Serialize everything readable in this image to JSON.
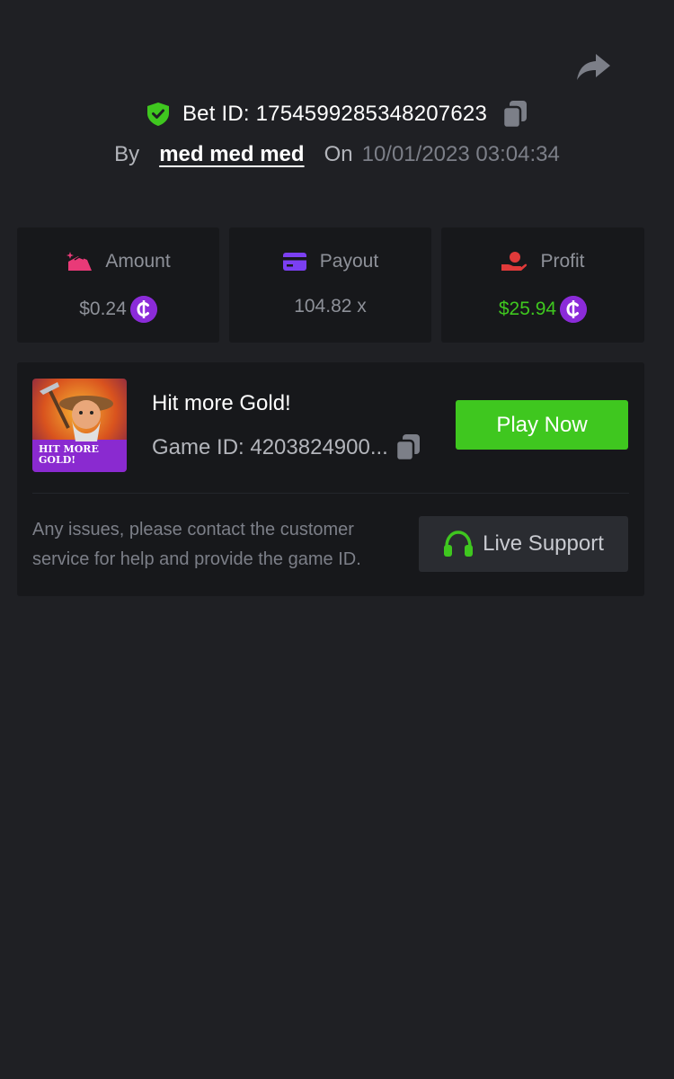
{
  "header": {
    "bet_id_text": "Bet ID: 1754599285348207623",
    "by_label": "By",
    "username": "med med med",
    "on_label": "On",
    "datetime": "10/01/2023 03:04:34"
  },
  "stats": [
    {
      "label": "Amount",
      "value": "$0.24",
      "icon": "money-bag-icon",
      "has_coin": true
    },
    {
      "label": "Payout",
      "value": "104.82 x",
      "icon": "card-icon",
      "has_coin": false
    },
    {
      "label": "Profit",
      "value": "$25.94",
      "icon": "hand-coin-icon",
      "has_coin": true,
      "value_color": "#3fc71f"
    }
  ],
  "game": {
    "title": "Hit more Gold!",
    "game_id_text": "Game ID: 4203824900...",
    "thumbnail_text": "HIT MORE GOLD!",
    "play_label": "Play Now"
  },
  "support": {
    "message": "Any issues, please contact the customer service for help and provide the game ID.",
    "button_label": "Live Support"
  },
  "colors": {
    "background": "#1f2024",
    "card": "#17181b",
    "accent_green": "#3fc71f",
    "coin_purple": "#8b2bd9",
    "amount_pink": "#e93a78",
    "payout_purple": "#7b3ff2",
    "profit_red": "#e03a3a"
  }
}
